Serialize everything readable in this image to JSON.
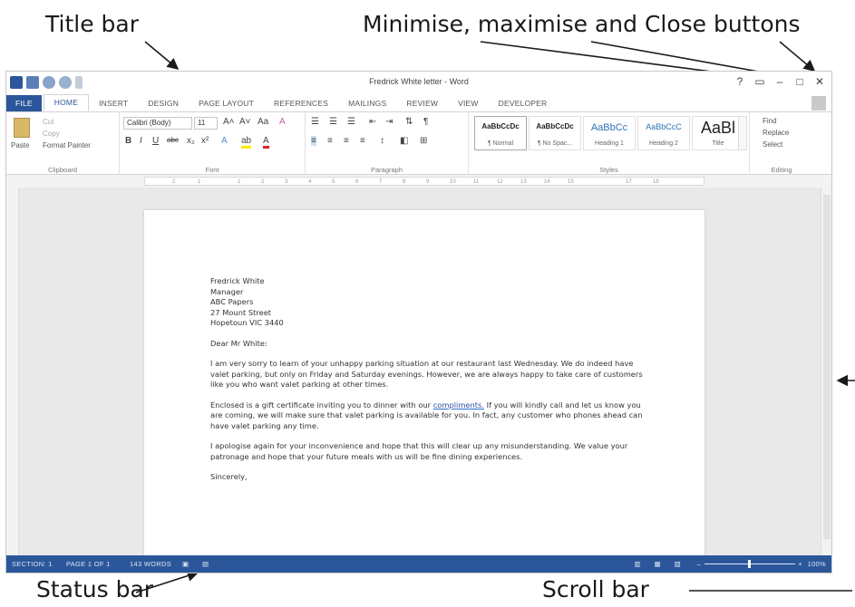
{
  "annotations": {
    "title_bar": "Title bar",
    "window_buttons": "Minimise, maximise and Close buttons",
    "status_bar": "Status bar",
    "scroll_bar": "Scroll bar"
  },
  "window": {
    "title": "Fredrick White letter - Word",
    "help": "?",
    "minimise": "–",
    "maximise": "□",
    "close": "✕"
  },
  "tabs": [
    "FILE",
    "HOME",
    "INSERT",
    "DESIGN",
    "PAGE LAYOUT",
    "REFERENCES",
    "MAILINGS",
    "REVIEW",
    "VIEW",
    "DEVELOPER"
  ],
  "active_tab": "HOME",
  "ribbon": {
    "clipboard": {
      "paste": "Paste",
      "cut": "Cut",
      "copy": "Copy",
      "format_painter": "Format Painter",
      "label": "Clipboard"
    },
    "font": {
      "name": "Calibri (Body)",
      "size": "11",
      "label": "Font"
    },
    "paragraph": {
      "label": "Paragraph"
    },
    "styles": {
      "label": "Styles",
      "items": [
        {
          "preview": "AaBbCcDc",
          "name": "¶ Normal"
        },
        {
          "preview": "AaBbCcDc",
          "name": "¶ No Spac..."
        },
        {
          "preview": "AaBbCc",
          "name": "Heading 1"
        },
        {
          "preview": "AaBbCcC",
          "name": "Heading 2"
        },
        {
          "preview": "AaBl",
          "name": "Title"
        }
      ]
    },
    "editing": {
      "find": "Find",
      "replace": "Replace",
      "select": "Select",
      "label": "Editing"
    }
  },
  "ruler_ticks": [
    "2",
    "1",
    "1",
    "2",
    "3",
    "4",
    "5",
    "6",
    "7",
    "8",
    "9",
    "10",
    "11",
    "12",
    "13",
    "14",
    "15",
    "17",
    "18"
  ],
  "letter": {
    "address": [
      "Fredrick White",
      "Manager",
      "ABC Papers",
      "27 Mount Street",
      "Hopetoun VIC 3440"
    ],
    "salutation": "Dear Mr White:",
    "p1": "I am very sorry to learn of your unhappy parking situation at our restaurant last Wednesday. We do indeed have valet parking, but only on Friday and Saturday evenings. However, we are always happy to take care of customers like you who want valet parking at other times.",
    "p2_before": "Enclosed is a gift certificate inviting you to dinner with our ",
    "p2_link": "compliments.",
    "p2_after": " If you will kindly call and let us know you are coming, we will make sure that valet parking is available for you. In fact, any customer who phones ahead can have valet parking any time.",
    "p3": "I apologise again for your inconvenience and hope that this will clear up any misunderstanding. We value your patronage and hope that your future meals with us will be fine dining experiences.",
    "closing": "Sincerely,"
  },
  "status": {
    "section": "SECTION: 1",
    "page": "PAGE 1 OF 1",
    "words": "143 WORDS",
    "zoom": "100%"
  },
  "colors": {
    "accent": "#2b579a"
  }
}
